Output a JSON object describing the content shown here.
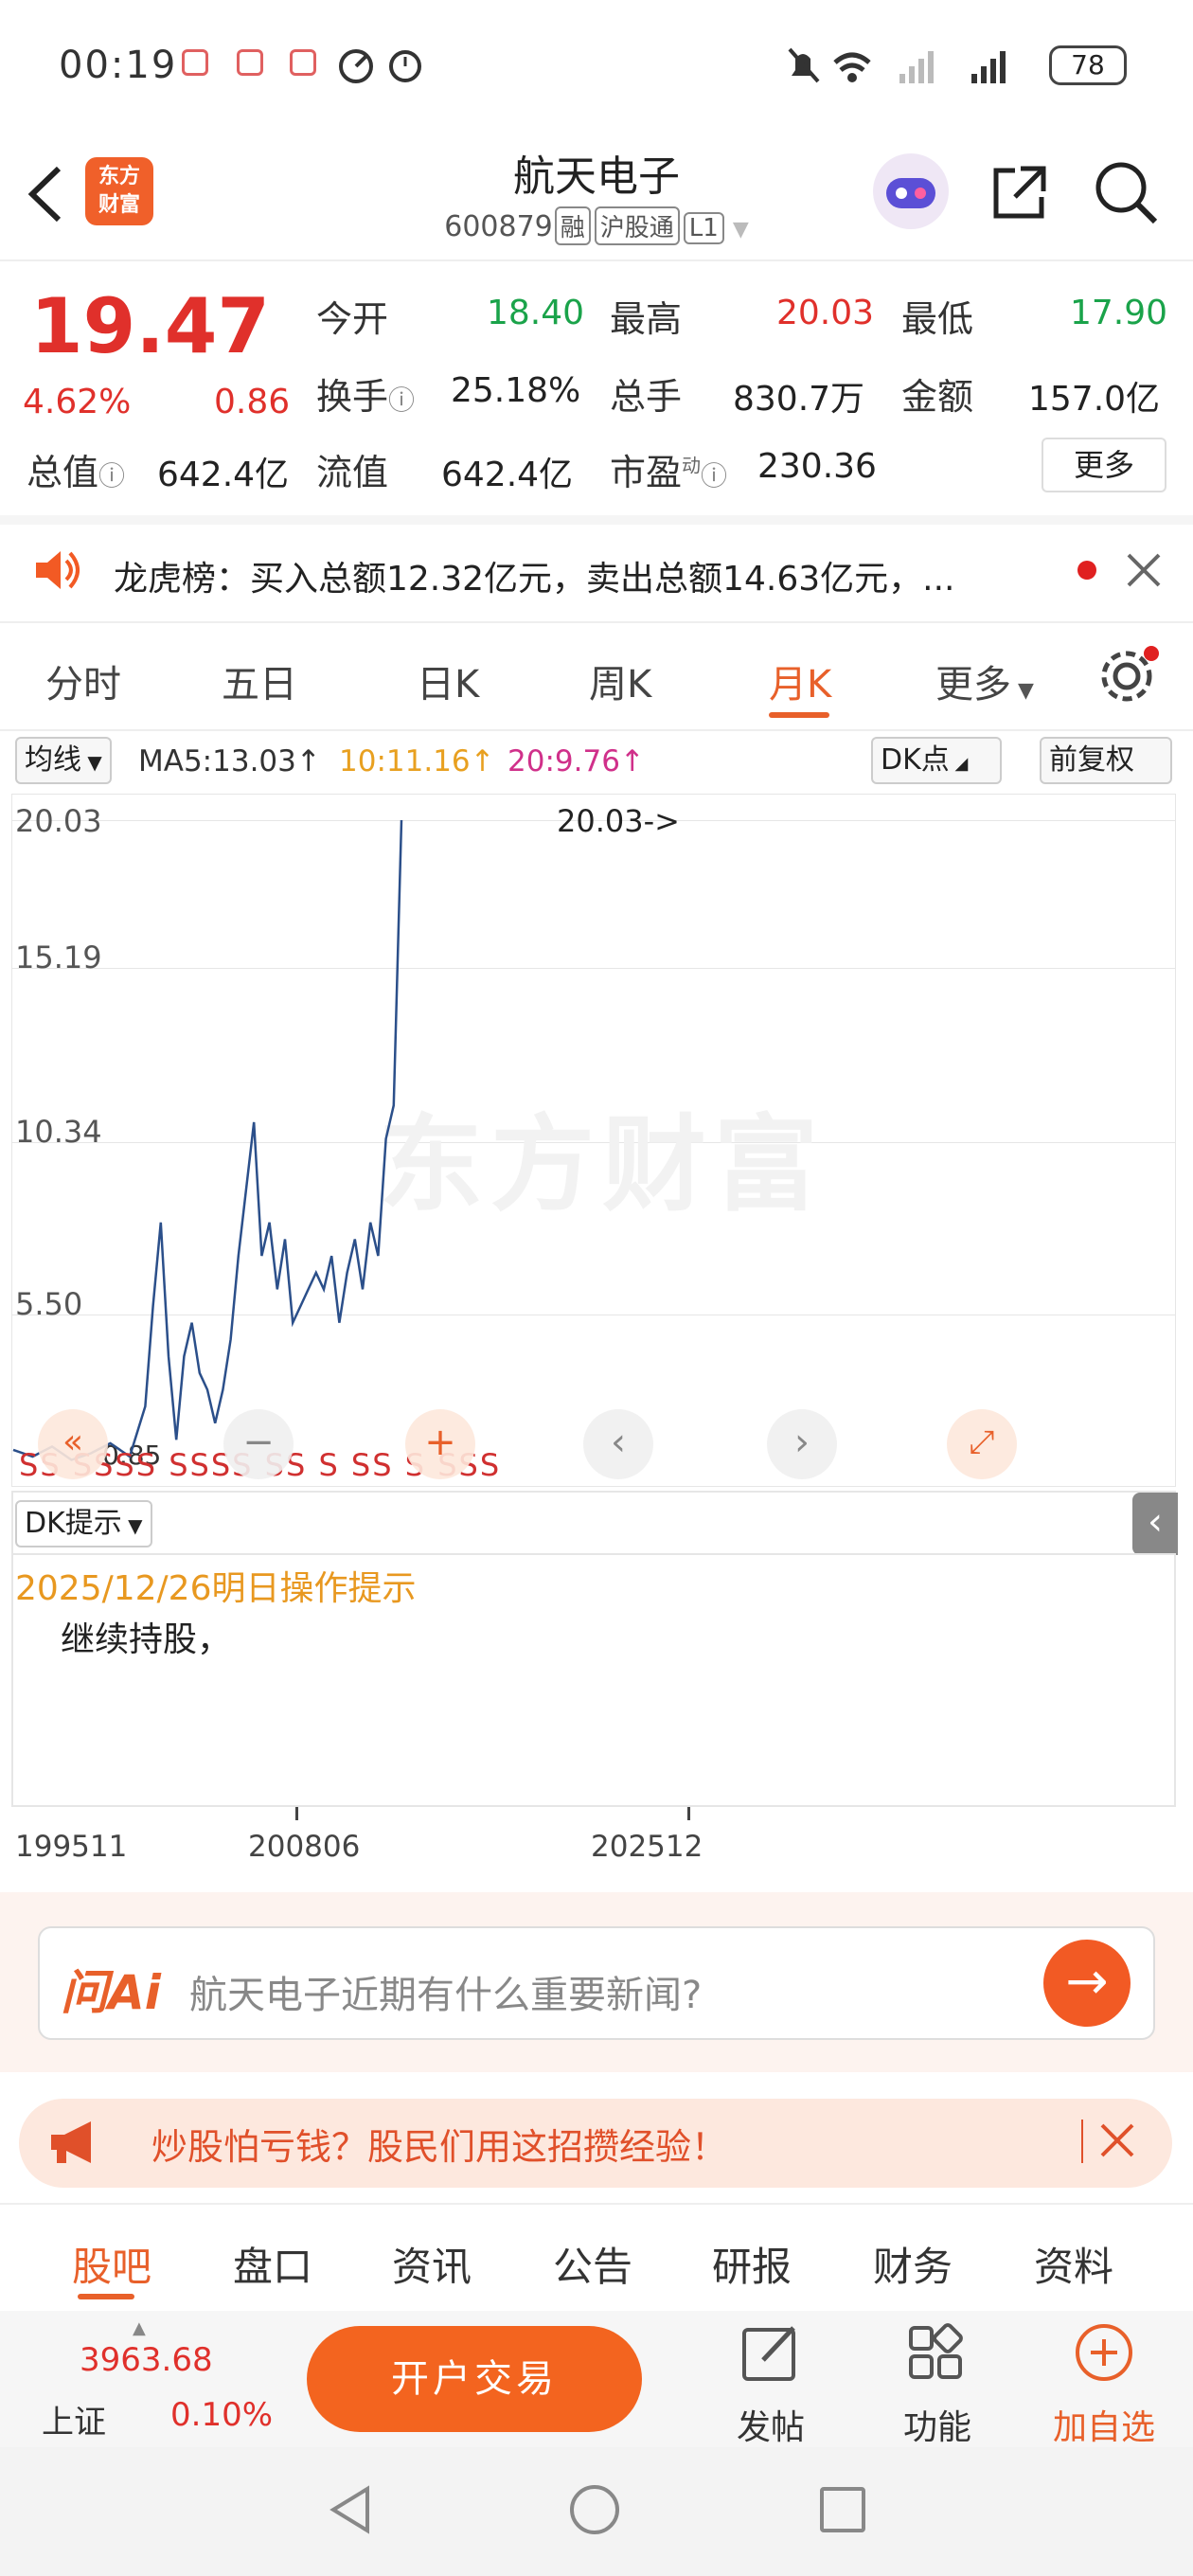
{
  "status": {
    "time": "00:19",
    "battery": "78"
  },
  "header": {
    "logo_top": "东方",
    "logo_bottom": "财富",
    "title": "航天电子",
    "code": "600879",
    "tags": [
      "融",
      "沪股通",
      "L1"
    ]
  },
  "quote": {
    "price": "19.47",
    "change_pct": "4.62%",
    "change_abs": "0.86",
    "fields": {
      "open_label": "今开",
      "open": "18.40",
      "high_label": "最高",
      "high": "20.03",
      "low_label": "最低",
      "low": "17.90",
      "turnover_label": "换手",
      "turnover": "25.18%",
      "volume_label": "总手",
      "volume": "830.7万",
      "amount_label": "金额",
      "amount": "157.0亿",
      "mktcap_label": "总值",
      "mktcap": "642.4亿",
      "float_label": "流值",
      "float": "642.4亿",
      "pe_label": "市盈",
      "pe_sup": "动",
      "pe": "230.36"
    },
    "more": "更多"
  },
  "banner": {
    "text": "龙虎榜：买入总额12.32亿元，卖出总额14.63亿元，..."
  },
  "tabs": [
    "分时",
    "五日",
    "日K",
    "周K",
    "月K",
    "更多"
  ],
  "active_tab": "月K",
  "indicators": {
    "ma_select": "均线",
    "ma5": "MA5:13.03",
    "ma10": "10:11.16",
    "ma20": "20:9.76",
    "dk_select": "DK点",
    "adjust": "前复权"
  },
  "chart_data": {
    "type": "line",
    "title": "",
    "y_ticks": [
      "20.03",
      "15.19",
      "10.34",
      "5.50"
    ],
    "y_range": [
      0.66,
      20.03
    ],
    "peak_label": "20.03->",
    "low_label": "0.85",
    "x_ticks": [
      "199511",
      "200806",
      "202512"
    ],
    "series": [
      {
        "x": [
          0,
          5,
          10,
          15,
          20,
          25,
          30,
          34,
          36,
          38,
          40,
          42,
          44,
          46,
          48,
          50,
          52,
          54,
          56,
          58,
          60,
          62,
          64,
          66,
          68,
          70,
          72,
          74,
          76,
          78,
          80,
          82,
          84,
          86,
          88,
          90,
          92,
          94,
          96,
          98,
          100
        ],
        "values": [
          1.2,
          1.0,
          1.3,
          0.9,
          1.1,
          1.4,
          1.0,
          2.5,
          5.5,
          8.0,
          4.0,
          1.5,
          4.0,
          5.0,
          3.5,
          3.0,
          2.0,
          3.0,
          4.5,
          7.0,
          9.0,
          11.0,
          7.0,
          8.0,
          6.0,
          7.5,
          5.0,
          5.5,
          6.0,
          6.5,
          6.0,
          7.0,
          5.0,
          6.5,
          7.5,
          6.0,
          8.0,
          7.0,
          10.5,
          11.5,
          20.03
        ]
      }
    ]
  },
  "signals": "SS SSSS SSSS SS S SS S SSS",
  "dk": {
    "select": "DK提示",
    "date_title": "2025/12/26明日操作提示",
    "text": "继续持股，"
  },
  "ask": {
    "brand": "问Ai",
    "placeholder": "航天电子近期有什么重要新闻?"
  },
  "promo": {
    "text": "炒股怕亏钱？股民们用这招攒经验！"
  },
  "bottom_tabs": [
    "股吧",
    "盘口",
    "资讯",
    "公告",
    "研报",
    "财务",
    "资料"
  ],
  "footer": {
    "index_value": "3963.68",
    "index_name": "上证",
    "index_change": "0.10%",
    "trade": "开户交易",
    "post": "发帖",
    "func": "功能",
    "add": "加自选"
  },
  "colors": {
    "up": "#e0302b",
    "down": "#1aa34a",
    "accent": "#e8602a",
    "line": "#2b4f8a"
  }
}
